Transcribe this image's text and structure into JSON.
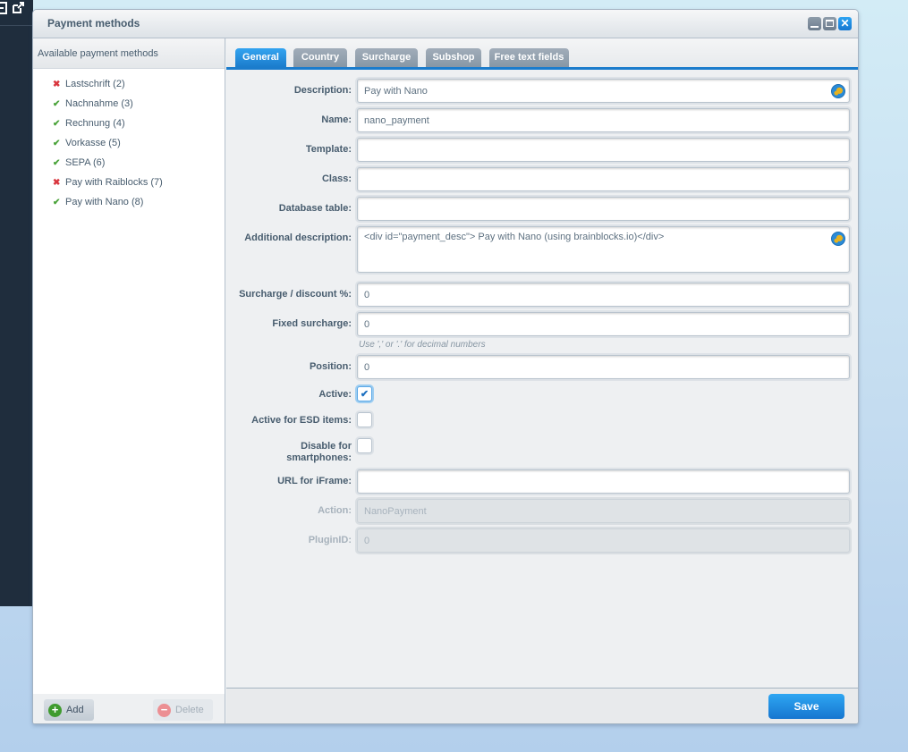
{
  "window": {
    "title": "Payment methods",
    "controls": [
      "minimize",
      "maximize",
      "close"
    ]
  },
  "left_panel": {
    "header": "Available payment methods",
    "methods": [
      {
        "label": "Lastschrift (2)",
        "active": false
      },
      {
        "label": "Nachnahme (3)",
        "active": true
      },
      {
        "label": "Rechnung (4)",
        "active": true
      },
      {
        "label": "Vorkasse (5)",
        "active": true
      },
      {
        "label": "SEPA (6)",
        "active": true
      },
      {
        "label": "Pay with Raiblocks (7)",
        "active": false
      },
      {
        "label": "Pay with Nano (8)",
        "active": true
      }
    ],
    "add_label": "Add",
    "delete_label": "Delete"
  },
  "tabs": [
    {
      "label": "General",
      "active": true
    },
    {
      "label": "Country",
      "active": false
    },
    {
      "label": "Surcharge",
      "active": false
    },
    {
      "label": "Subshop",
      "active": false
    },
    {
      "label": "Free text fields",
      "active": false
    }
  ],
  "form": {
    "description": {
      "label": "Description:",
      "value": "Pay with Nano"
    },
    "name": {
      "label": "Name:",
      "value": "nano_payment"
    },
    "template": {
      "label": "Template:",
      "value": ""
    },
    "class": {
      "label": "Class:",
      "value": ""
    },
    "database_table": {
      "label": "Database table:",
      "value": ""
    },
    "additional_description": {
      "label": "Additional description:",
      "value": "<div id=\"payment_desc\">  Pay with Nano (using brainblocks.io)</div>"
    },
    "surcharge_discount": {
      "label": "Surcharge / discount %:",
      "value": "0"
    },
    "fixed_surcharge": {
      "label": "Fixed surcharge:",
      "value": "0",
      "hint": "Use ',' or '.' for decimal numbers"
    },
    "position": {
      "label": "Position:",
      "value": "0"
    },
    "active": {
      "label": "Active:",
      "checked": true
    },
    "active_esd": {
      "label": "Active for ESD items:",
      "checked": false
    },
    "disable_smartphones": {
      "label_line1": "Disable for",
      "label_line2": "smartphones:",
      "checked": false
    },
    "url_iframe": {
      "label": "URL for iFrame:",
      "value": ""
    },
    "action": {
      "label": "Action:",
      "value": "NanoPayment"
    },
    "plugin_id": {
      "label": "PluginID:",
      "value": "0"
    }
  },
  "footer": {
    "save_label": "Save"
  },
  "checkmark_glyph": "✔",
  "colors": {
    "accent": "#1b7ccc",
    "active_icon": "#4aa33a",
    "inactive_icon": "#d9363e"
  }
}
